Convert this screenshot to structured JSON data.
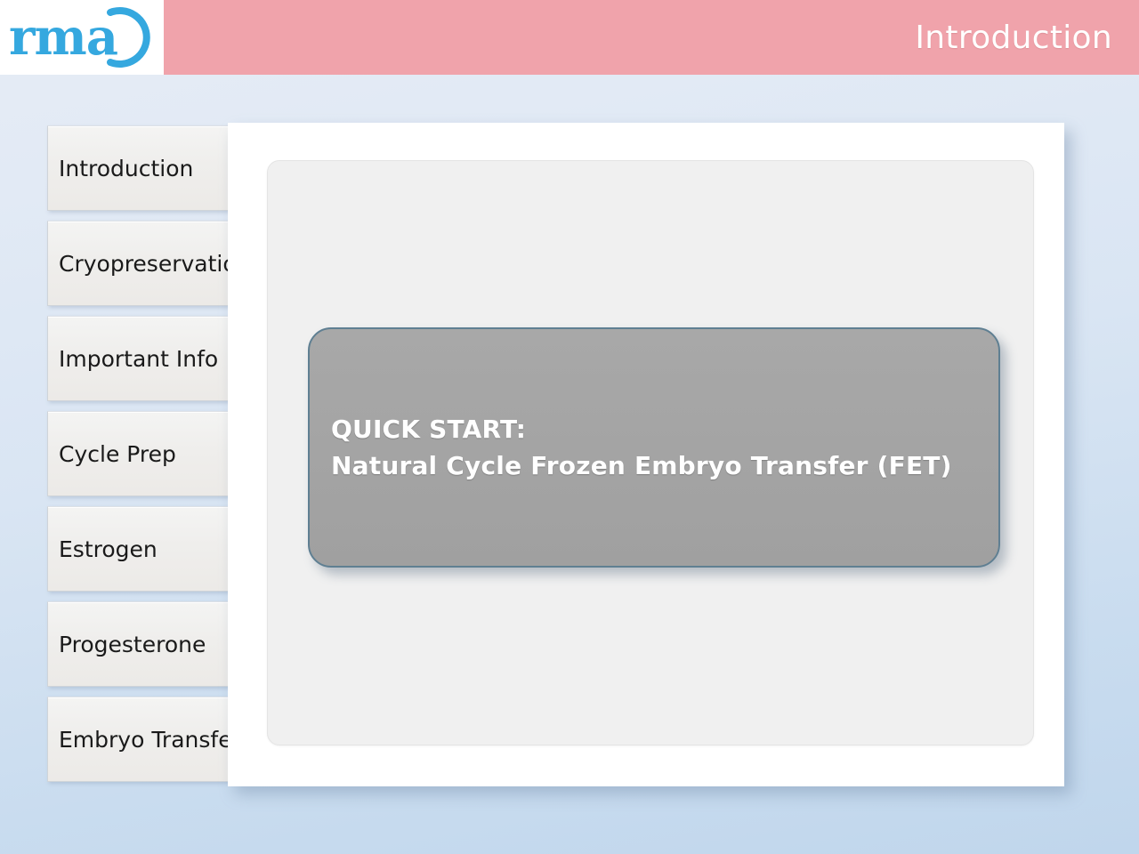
{
  "header": {
    "logo_text": "rma",
    "logo_icon": "open-circle-arc-icon",
    "title": "Introduction",
    "pink_color": "#f0a3ab",
    "logo_color": "#35a8df"
  },
  "sidebar": {
    "items": [
      {
        "label": "Introduction"
      },
      {
        "label": "Cryopreservation"
      },
      {
        "label": "Important Info"
      },
      {
        "label": "Cycle Prep"
      },
      {
        "label": "Estrogen"
      },
      {
        "label": "Progesterone"
      },
      {
        "label": "Embryo Transfer"
      }
    ]
  },
  "main": {
    "callout": {
      "heading": "QUICK START:",
      "subheading": "Natural Cycle Frozen Embryo Transfer (FET)",
      "box_color": "#a5a5a5",
      "border_color": "#5f7f92",
      "text_color": "#ffffff"
    }
  },
  "background": {
    "color_top": "#e6ecf5",
    "color_bottom": "#c0d6ec"
  }
}
